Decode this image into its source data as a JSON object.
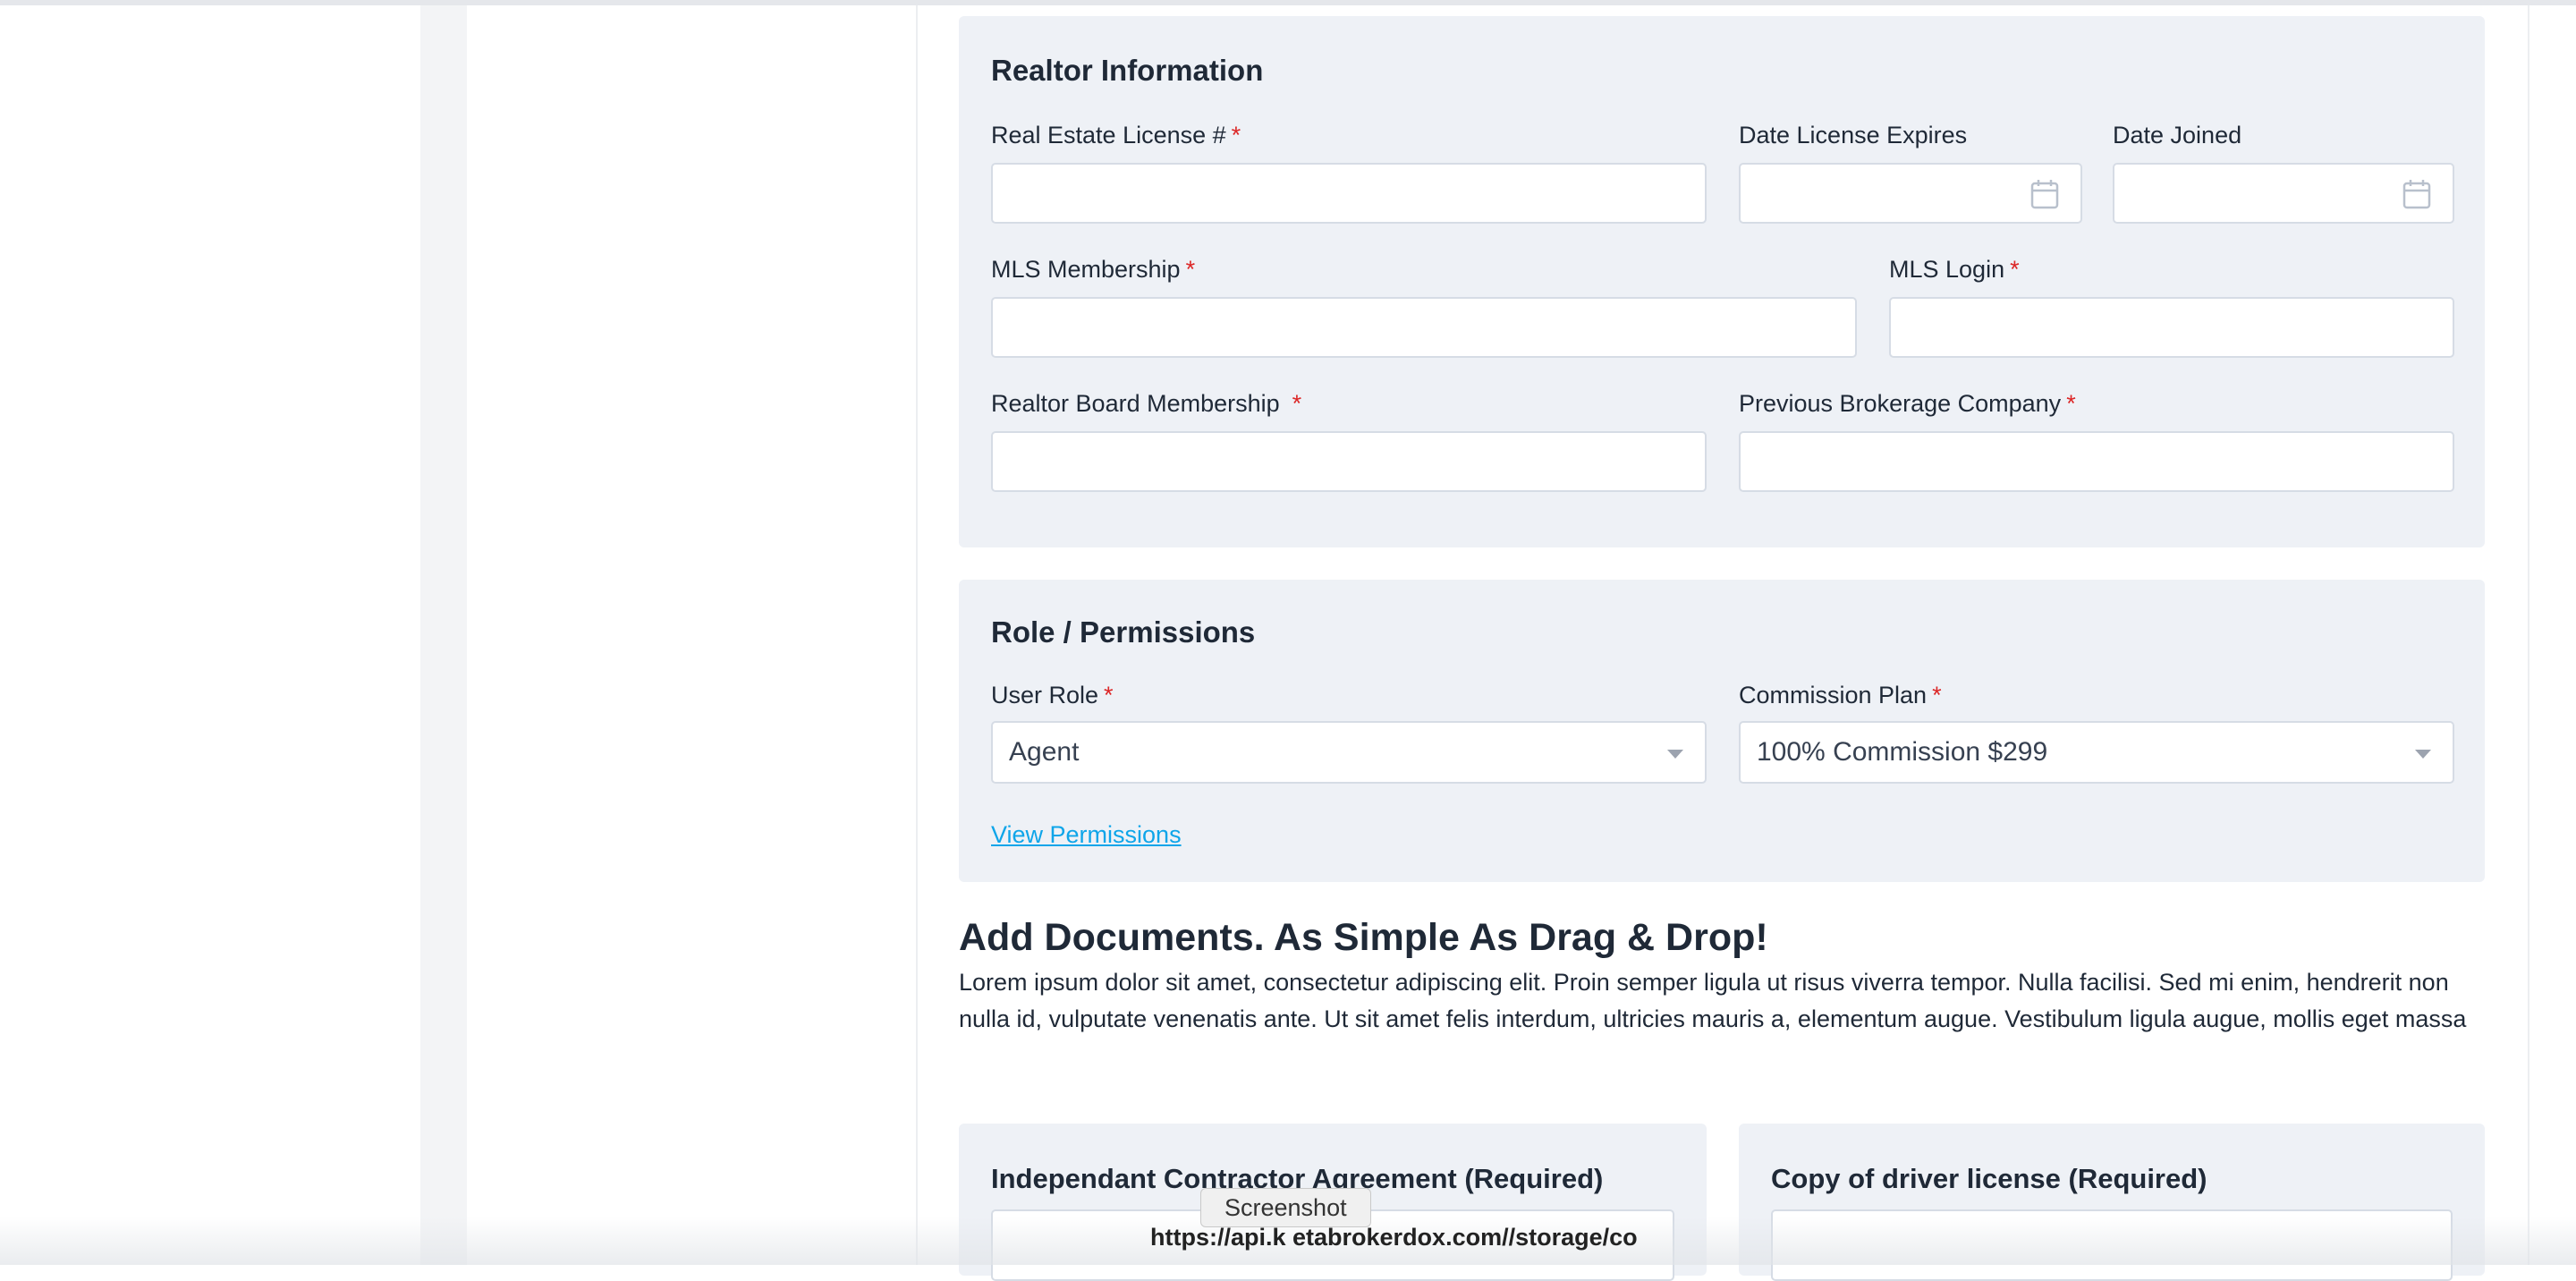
{
  "realtor": {
    "title": "Realtor Information",
    "license_label": "Real Estate License #",
    "license_value": "",
    "expires_label": "Date License Expires",
    "expires_value": "",
    "joined_label": "Date Joined",
    "joined_value": "",
    "mls_membership_label": "MLS Membership",
    "mls_membership_value": "",
    "mls_login_label": "MLS Login",
    "mls_login_value": "",
    "board_label": "Realtor Board Membership",
    "board_value": "",
    "prev_brokerage_label": "Previous Brokerage Company",
    "prev_brokerage_value": "",
    "required_mark": "*"
  },
  "role": {
    "title": "Role / Permissions",
    "user_role_label": "User Role",
    "user_role_value": "Agent",
    "commission_label": "Commission Plan",
    "commission_value": "100% Commission $299",
    "view_permissions": "View Permissions",
    "required_mark": "*"
  },
  "documents": {
    "heading": "Add Documents. As Simple As Drag & Drop!",
    "description": "Lorem ipsum dolor sit amet, consectetur adipiscing elit. Proin semper ligula ut risus viverra tempor. Nulla facilisi. Sed mi enim, hendrerit non nulla id, vulputate venenatis ante. Ut sit amet felis interdum, ultricies mauris a, elementum augue. Vestibulum ligula augue, mollis eget massa",
    "cards": [
      {
        "title": "Independant Contractor Agreement (Required)"
      },
      {
        "title": "Copy of driver license (Required)"
      }
    ]
  },
  "overlay": {
    "tooltip": "Screenshot",
    "url": "https://api.k etabrokerdox.com//storage/co"
  },
  "colors": {
    "panel_bg": "#eef1f6",
    "required": "#dc2626",
    "link": "#0ea5e9",
    "text": "#1f2937"
  }
}
